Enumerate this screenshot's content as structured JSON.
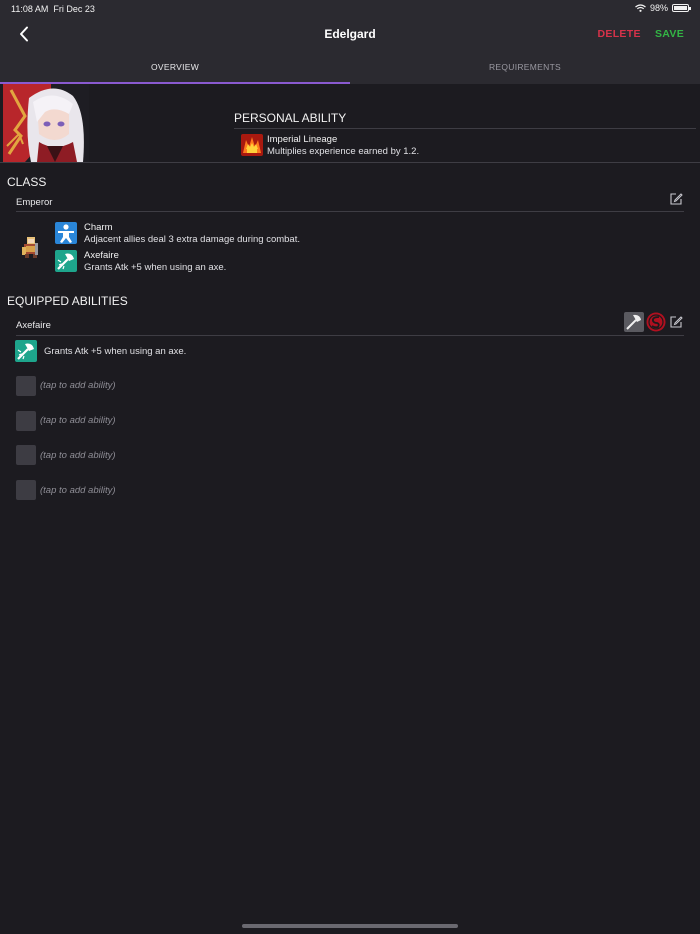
{
  "status_bar": {
    "time": "11:08 AM",
    "date": "Fri Dec 23",
    "battery": "98%",
    "battery_level": 0.98
  },
  "nav": {
    "title": "Edelgard",
    "delete_label": "DELETE",
    "save_label": "SAVE"
  },
  "tabs": [
    {
      "label": "OVERVIEW",
      "selected": true
    },
    {
      "label": "REQUIREMENTS",
      "selected": false
    }
  ],
  "personal_ability": {
    "header": "PERSONAL ABILITY",
    "name": "Imperial Lineage",
    "description": "Multiplies experience earned by 1.2.",
    "icon": "crown-icon"
  },
  "class": {
    "header": "CLASS",
    "name": "Emperor",
    "skills": [
      {
        "name": "Charm",
        "description": "Adjacent allies deal 3 extra damage during combat.",
        "icon": "charm-icon"
      },
      {
        "name": "Axefaire",
        "description": "Grants Atk +5 when using an axe.",
        "icon": "axe-icon"
      }
    ]
  },
  "equipped": {
    "header": "EQUIPPED ABILITIES",
    "name": "Axefaire",
    "ability": {
      "description": "Grants Atk +5 when using an axe.",
      "icon": "axe-icon"
    },
    "empty_slot_label": "(tap to add ability)",
    "empty_slots": [
      "(tap to add ability)",
      "(tap to add ability)",
      "(tap to add ability)",
      "(tap to add ability)"
    ]
  },
  "colors": {
    "background": "#1c1b20",
    "bar": "#2b2a30",
    "accent": "#8a5ad0",
    "delete": "#d6324a",
    "save": "#33b545",
    "skill_teal": "#1ea58c",
    "skill_blue": "#2a86d8"
  }
}
